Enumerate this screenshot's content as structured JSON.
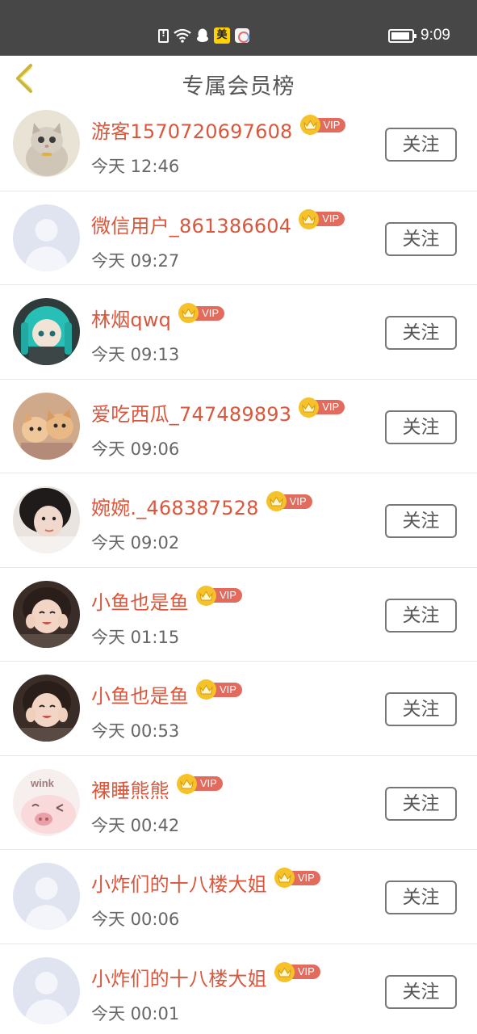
{
  "status_bar": {
    "time": "9:09",
    "icons": [
      "sim-alert-icon",
      "wifi-icon",
      "qq-icon",
      "meituan-icon",
      "app-icon",
      "battery-icon"
    ],
    "meituan_label": "美"
  },
  "header": {
    "title": "专属会员榜",
    "back_icon": "chevron-left-icon",
    "accent": "#f6c22a"
  },
  "colors": {
    "name": "#d9573c",
    "vip_badge": "#e36b5d",
    "crown": "#f6c22a",
    "status_bar": "#474747"
  },
  "vip_label": "VIP",
  "members": [
    {
      "name": "游客1570720697608",
      "time": "今天 12:46",
      "follow": "关注",
      "avatar": "cat-avatar"
    },
    {
      "name": "微信用户_861386604",
      "time": "今天 09:27",
      "follow": "关注",
      "avatar": "default-avatar"
    },
    {
      "name": "林烟qwq",
      "time": "今天 09:13",
      "follow": "关注",
      "avatar": "doll-avatar"
    },
    {
      "name": "爱吃西瓜_747489893",
      "time": "今天 09:06",
      "follow": "关注",
      "avatar": "cats-avatar"
    },
    {
      "name": "婉婉._468387528",
      "time": "今天 09:02",
      "follow": "关注",
      "avatar": "girl-avatar"
    },
    {
      "name": "小鱼也是鱼",
      "time": "今天 01:15",
      "follow": "关注",
      "avatar": "girl-smile-avatar"
    },
    {
      "name": "小鱼也是鱼",
      "time": "今天 00:53",
      "follow": "关注",
      "avatar": "girl-smile-avatar"
    },
    {
      "name": "裸睡熊熊",
      "time": "今天 00:42",
      "follow": "关注",
      "avatar": "pig-avatar",
      "avatar_text": "wink"
    },
    {
      "name": "小炸们的十八楼大姐",
      "time": "今天 00:06",
      "follow": "关注",
      "avatar": "default-avatar"
    },
    {
      "name": "小炸们的十八楼大姐",
      "time": "今天 00:01",
      "follow": "关注",
      "avatar": "default-avatar"
    }
  ]
}
